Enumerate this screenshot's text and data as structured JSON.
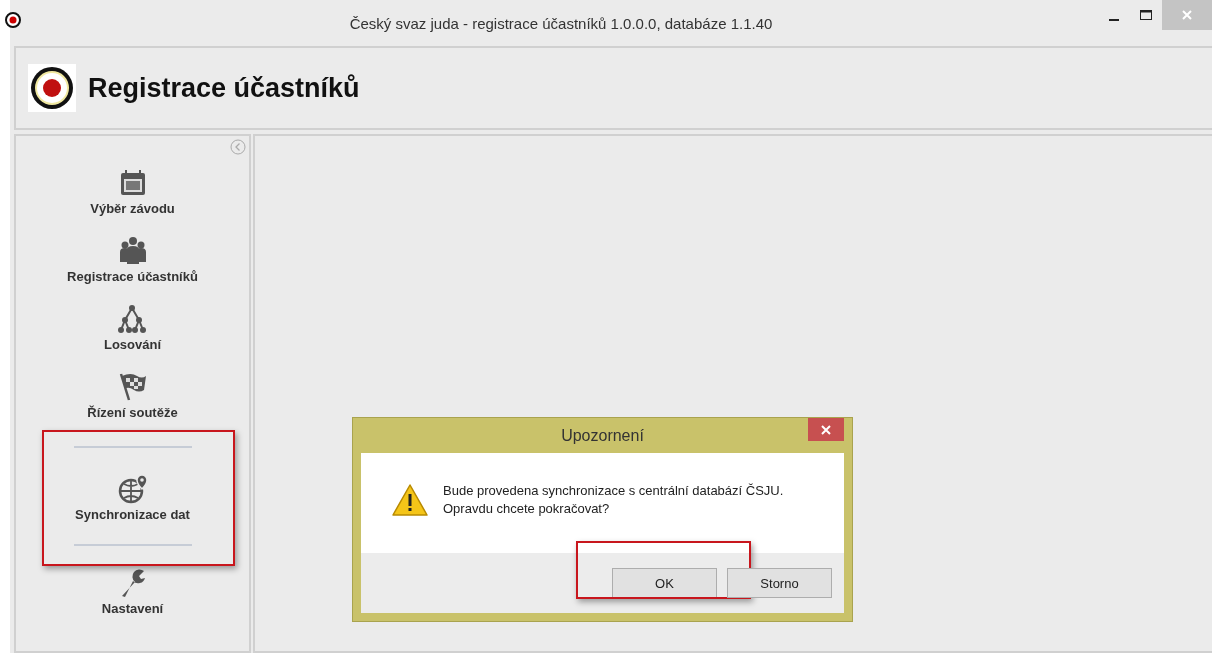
{
  "window": {
    "title": "Český svaz juda - registrace účastníků 1.0.0.0, databáze 1.1.40"
  },
  "header": {
    "title": "Registrace účastníků"
  },
  "sidebar": {
    "items": [
      {
        "label": "Výběr závodu",
        "selected": false,
        "highlighted": false
      },
      {
        "label": "Registrace účastníků",
        "selected": false,
        "highlighted": false
      },
      {
        "label": "Losování",
        "selected": false,
        "highlighted": false
      },
      {
        "label": "Řízení soutěže",
        "selected": false,
        "highlighted": false
      },
      {
        "label": "Synchronizace dat",
        "selected": true,
        "highlighted": true
      },
      {
        "label": "Nastavení",
        "selected": false,
        "highlighted": false
      }
    ]
  },
  "dialog": {
    "title": "Upozornení",
    "message": "Bude provedena synchronizace s centrální databází ČSJU.\nOpravdu chcete pokračovat?",
    "buttons": [
      {
        "label": "OK",
        "highlighted": true
      },
      {
        "label": "Storno",
        "highlighted": false
      }
    ]
  }
}
